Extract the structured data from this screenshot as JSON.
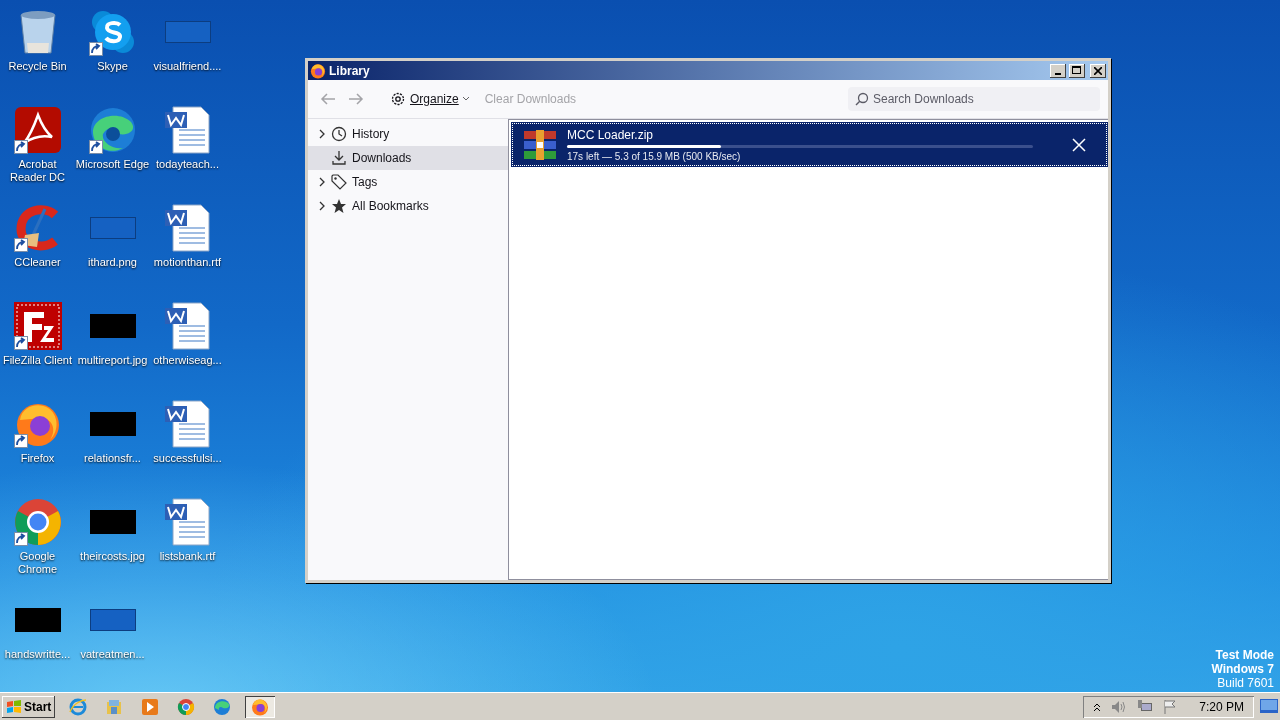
{
  "desktop_icons": [
    {
      "label": "Recycle Bin",
      "kind": "recycle-bin",
      "shortcut": false
    },
    {
      "label": "Skype",
      "kind": "skype",
      "shortcut": true
    },
    {
      "label": "visualfriend....",
      "kind": "blank-image",
      "shortcut": false
    },
    {
      "label": "Acrobat Reader DC",
      "kind": "acrobat",
      "shortcut": true
    },
    {
      "label": "Microsoft Edge",
      "kind": "edge",
      "shortcut": true
    },
    {
      "label": "todayteach...",
      "kind": "word",
      "shortcut": false
    },
    {
      "label": "CCleaner",
      "kind": "ccleaner",
      "shortcut": true
    },
    {
      "label": "ithard.png",
      "kind": "blank-image",
      "shortcut": false
    },
    {
      "label": "motionthan.rtf",
      "kind": "word",
      "shortcut": false
    },
    {
      "label": "FileZilla Client",
      "kind": "filezilla",
      "shortcut": true
    },
    {
      "label": "multireport.jpg",
      "kind": "black-image",
      "shortcut": false
    },
    {
      "label": "otherwiseag...",
      "kind": "word",
      "shortcut": false
    },
    {
      "label": "Firefox",
      "kind": "firefox",
      "shortcut": true
    },
    {
      "label": "relationsfr...",
      "kind": "black-image",
      "shortcut": false
    },
    {
      "label": "successfulsi...",
      "kind": "word",
      "shortcut": false
    },
    {
      "label": "Google Chrome",
      "kind": "chrome",
      "shortcut": true
    },
    {
      "label": "theircosts.jpg",
      "kind": "black-image",
      "shortcut": false
    },
    {
      "label": "listsbank.rtf",
      "kind": "word",
      "shortcut": false
    },
    {
      "label": "handswritte...",
      "kind": "black-image",
      "shortcut": false
    },
    {
      "label": "vatreatmen...",
      "kind": "blank-image",
      "shortcut": false
    }
  ],
  "window": {
    "title": "Library",
    "toolbar": {
      "nav": [
        {
          "kind": "back",
          "disabled": true
        },
        {
          "kind": "forward",
          "disabled": true
        }
      ],
      "organize": "Organize",
      "clear": {
        "label": "Clear Downloads",
        "disabled": true
      },
      "search": {
        "placeholder": "Search Downloads"
      }
    },
    "sidebar": {
      "items": [
        {
          "label": "History",
          "kind": "history",
          "expandable": true,
          "selected": false
        },
        {
          "label": "Downloads",
          "kind": "downloads",
          "expandable": false,
          "selected": true
        },
        {
          "label": "Tags",
          "kind": "tags",
          "expandable": true,
          "selected": false
        },
        {
          "label": "All Bookmarks",
          "kind": "bookmarks",
          "expandable": true,
          "selected": false
        }
      ]
    },
    "downloads": [
      {
        "name": "MCC Loader.zip",
        "status": "17s left — 5.3 of 15.9 MB (500 KB/sec)",
        "level": 0.33,
        "selected": true
      }
    ]
  },
  "system_text": [
    "Test Mode",
    "Windows 7",
    "Build 7601"
  ],
  "taskbar": {
    "start": "Start",
    "apps": [
      {
        "kind": "ie",
        "active": false
      },
      {
        "kind": "explorer",
        "active": false
      },
      {
        "kind": "media",
        "active": false
      },
      {
        "kind": "chrome",
        "active": false
      },
      {
        "kind": "edge",
        "active": false
      },
      {
        "kind": "firefox",
        "active": true
      }
    ],
    "clock": "7:20 PM"
  }
}
